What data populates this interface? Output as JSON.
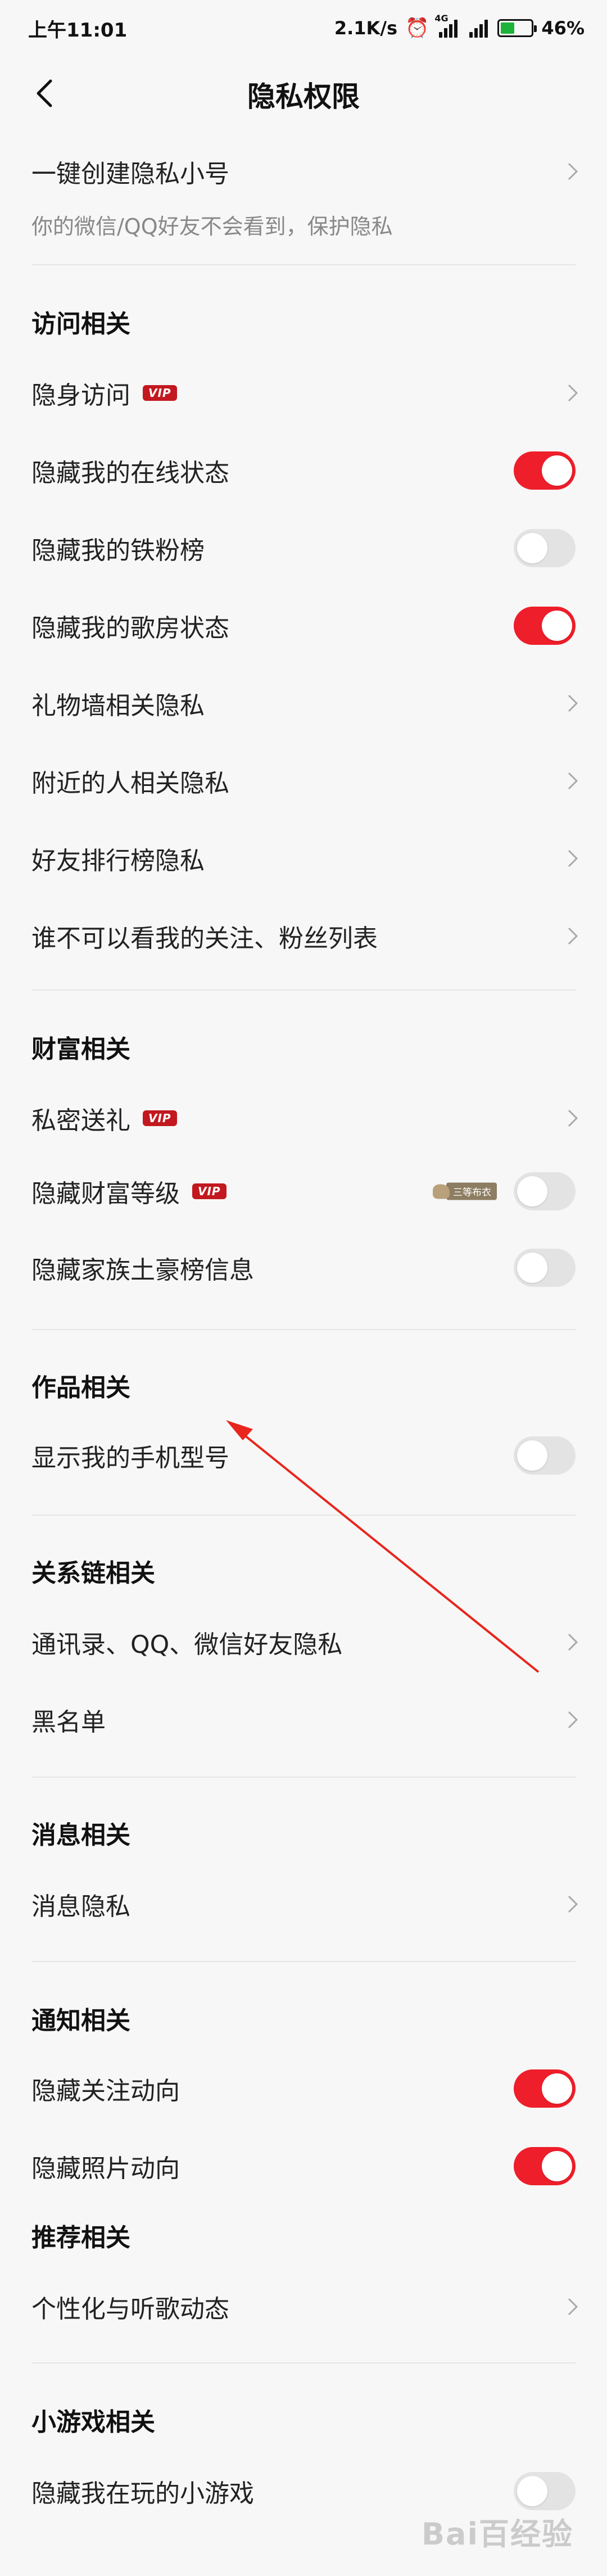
{
  "status_bar": {
    "time": "上午11:01",
    "speed": "2.1K/s",
    "net_label": "4G",
    "battery": "46%",
    "battery_level": 0.46
  },
  "header": {
    "title": "隐私权限"
  },
  "top": {
    "label": "一键创建隐私小号",
    "sub": "你的微信/QQ好友不会看到，保护隐私"
  },
  "sections": {
    "visit": "访问相关",
    "wealth": "财富相关",
    "works": "作品相关",
    "relation": "关系链相关",
    "message": "消息相关",
    "notify": "通知相关",
    "recommend": "推荐相关",
    "games": "小游戏相关"
  },
  "items": {
    "stealth_visit": "隐身访问",
    "hide_online": "隐藏我的在线状态",
    "hide_fans": "隐藏我的铁粉榜",
    "hide_room": "隐藏我的歌房状态",
    "gift_wall": "礼物墙相关隐私",
    "nearby": "附近的人相关隐私",
    "friend_rank": "好友排行榜隐私",
    "who_cant_see": "谁不可以看我的关注、粉丝列表",
    "private_gift": "私密送礼",
    "hide_wealth": "隐藏财富等级",
    "wealth_badge": "三等布衣",
    "hide_clan": "隐藏家族土豪榜信息",
    "show_phone": "显示我的手机型号",
    "contacts": "通讯录、QQ、微信好友隐私",
    "blacklist": "黑名单",
    "msg_privacy": "消息隐私",
    "hide_follow": "隐藏关注动向",
    "hide_photo": "隐藏照片动向",
    "personalize": "个性化与听歌动态",
    "hide_games": "隐藏我在玩的小游戏"
  },
  "vip_label": "VIP",
  "watermark": "Bai百经验",
  "colors": {
    "accent": "#ee1e2a",
    "vip": "#c3181f"
  }
}
